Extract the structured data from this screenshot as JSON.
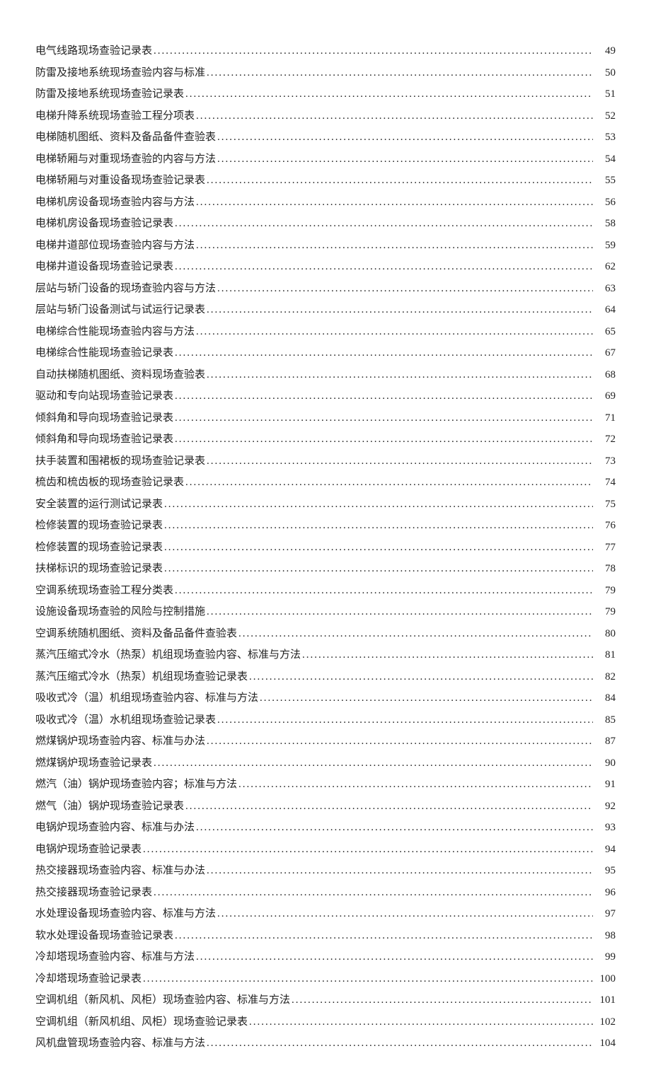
{
  "toc": [
    {
      "title": "电气线路现场查验记录表",
      "page": "49"
    },
    {
      "title": "防雷及接地系统现场查验内容与标准",
      "page": "50"
    },
    {
      "title": "防雷及接地系统现场查验记录表",
      "page": "51"
    },
    {
      "title": "电梯升降系统现场查验工程分项表",
      "page": "52"
    },
    {
      "title": "电梯随机图纸、资料及备品备件查验表",
      "page": "53"
    },
    {
      "title": "电梯轿厢与对重现场查验的内容与方法",
      "page": "54"
    },
    {
      "title": "电梯轿厢与对重设备现场查验记录表",
      "page": "55"
    },
    {
      "title": "电梯机房设备现场查验内容与方法",
      "page": "56"
    },
    {
      "title": "电梯机房设备现场查验记录表",
      "page": "58"
    },
    {
      "title": "电梯井道部位现场查验内容与方法",
      "page": "59"
    },
    {
      "title": "电梯井道设备现场查验记录表",
      "page": "62"
    },
    {
      "title": "层站与轿门设备的现场查验内容与方法",
      "page": "63"
    },
    {
      "title": "层站与轿门设备测试与试运行记录表",
      "page": "64"
    },
    {
      "title": "电梯综合性能现场查验内容与方法",
      "page": "65"
    },
    {
      "title": "电梯综合性能现场查验记录表",
      "page": "67"
    },
    {
      "title": "自动扶梯随机图纸、资料现场查验表",
      "page": "68"
    },
    {
      "title": "驱动和专向站现场查验记录表",
      "page": "69"
    },
    {
      "title": "倾斜角和导向现场查验记录表",
      "page": "71"
    },
    {
      "title": "倾斜角和导向现场查验记录表",
      "page": "72"
    },
    {
      "title": "扶手装置和围裙板的现场查验记录表",
      "page": "73"
    },
    {
      "title": "梳齿和梳齿板的现场查验记录表",
      "page": "74"
    },
    {
      "title": "安全装置的运行测试记录表",
      "page": "75"
    },
    {
      "title": "检修装置的现场查验记录表",
      "page": "76"
    },
    {
      "title": "检修装置的现场查验记录表",
      "page": "77"
    },
    {
      "title": "扶梯标识的现场查验记录表",
      "page": "78"
    },
    {
      "title": "空调系统现场查验工程分类表",
      "page": "79"
    },
    {
      "title": "设施设备现场查验的风险与控制措施",
      "page": "79"
    },
    {
      "title": "空调系统随机图纸、资料及备品备件查验表",
      "page": "80"
    },
    {
      "title": "蒸汽压缩式冷水（热泵）机组现场查验内容、标准与方法",
      "page": "81"
    },
    {
      "title": "蒸汽压缩式冷水（热泵）机组现场查验记录表",
      "page": "82"
    },
    {
      "title": "吸收式冷（温）机组现场查验内容、标准与方法",
      "page": "84"
    },
    {
      "title": "吸收式冷（温）水机组现场查验记录表",
      "page": "85"
    },
    {
      "title": "燃煤锅炉现场查验内容、标准与办法",
      "page": "87"
    },
    {
      "title": "燃煤锅炉现场查验记录表",
      "page": "90"
    },
    {
      "title": "燃汽（油）锅炉现场查验内容；标准与方法",
      "page": "91"
    },
    {
      "title": "燃气（油）锅炉现场查验记录表",
      "page": "92"
    },
    {
      "title": "电锅炉现场查验内容、标准与办法",
      "page": "93"
    },
    {
      "title": "电锅炉现场查验记录表",
      "page": "94"
    },
    {
      "title": "热交接器现场查验内容、标准与办法",
      "page": "95"
    },
    {
      "title": "热交接器现场查验记录表",
      "page": "96"
    },
    {
      "title": "水处理设备现场查验内容、标准与方法",
      "page": "97"
    },
    {
      "title": "软水处理设备现场查验记录表",
      "page": "98"
    },
    {
      "title": "冷却塔现场查验内容、标准与方法",
      "page": "99"
    },
    {
      "title": "冷却塔现场查验记录表",
      "page": "100"
    },
    {
      "title": "空调机组（新风机、风柜）现场查验内容、标准与方法",
      "page": "101"
    },
    {
      "title": "空调机组（新风机组、风柜）现场查验记录表",
      "page": "102"
    },
    {
      "title": "风机盘管现场查验内容、标准与方法",
      "page": "104"
    }
  ]
}
